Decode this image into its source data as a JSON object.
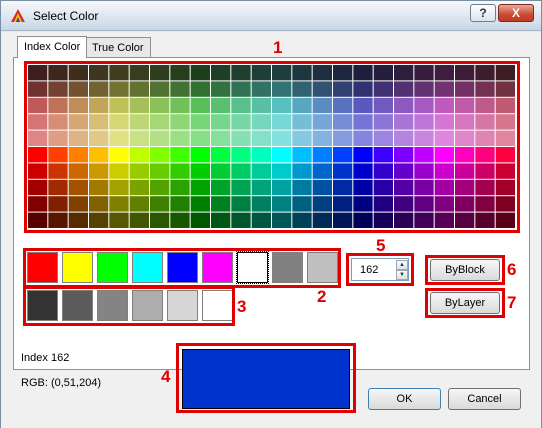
{
  "window": {
    "title": "Select Color",
    "help_label": "?",
    "close_label": "X"
  },
  "tabs": [
    {
      "label": "Index Color",
      "active": true
    },
    {
      "label": "True Color",
      "active": false
    }
  ],
  "annotations": {
    "1": "1",
    "2": "2",
    "3": "3",
    "4": "4",
    "5": "5",
    "6": "6",
    "7": "7"
  },
  "annotation_color": "#e00000",
  "palette": {
    "columns": 24,
    "rows": 10,
    "hue_columns": [
      "red",
      "red-orange",
      "orange",
      "amber",
      "yellow",
      "yellow-green",
      "chartreuse",
      "lime",
      "green",
      "green2",
      "spring",
      "aquamarine",
      "cyan",
      "sky",
      "azure",
      "blue2",
      "blue",
      "violet",
      "purple",
      "magenta",
      "fuchsia",
      "rose",
      "crimson",
      "pink-red"
    ],
    "row_style": [
      "dark-pastel",
      "muted-pastel",
      "light-pastel",
      "lighter-pastel",
      "bright-pastel",
      "full",
      "dark-1",
      "dark-2",
      "dark-3",
      "darkest"
    ]
  },
  "standard_colors": {
    "row1": [
      "#ff0000",
      "#ffff00",
      "#00ff00",
      "#00ffff",
      "#0000ff",
      "#ff00ff",
      "#ffffff",
      "#808080",
      "#c0c0c0"
    ],
    "row2": [
      "#333333",
      "#5b5b5b",
      "#848484",
      "#adadad",
      "#d6d6d6",
      "#ffffff"
    ]
  },
  "index_spinner": {
    "value": "162",
    "up_icon": "spin-up-arrow",
    "down_icon": "spin-down-arrow"
  },
  "buttons": {
    "byblock": "ByBlock",
    "bylayer": "ByLayer",
    "ok": "OK",
    "cancel": "Cancel"
  },
  "info": {
    "index_label": "Index 162",
    "rgb_label": "RGB: (0,51,204)"
  },
  "preview_color": "#0033cc"
}
